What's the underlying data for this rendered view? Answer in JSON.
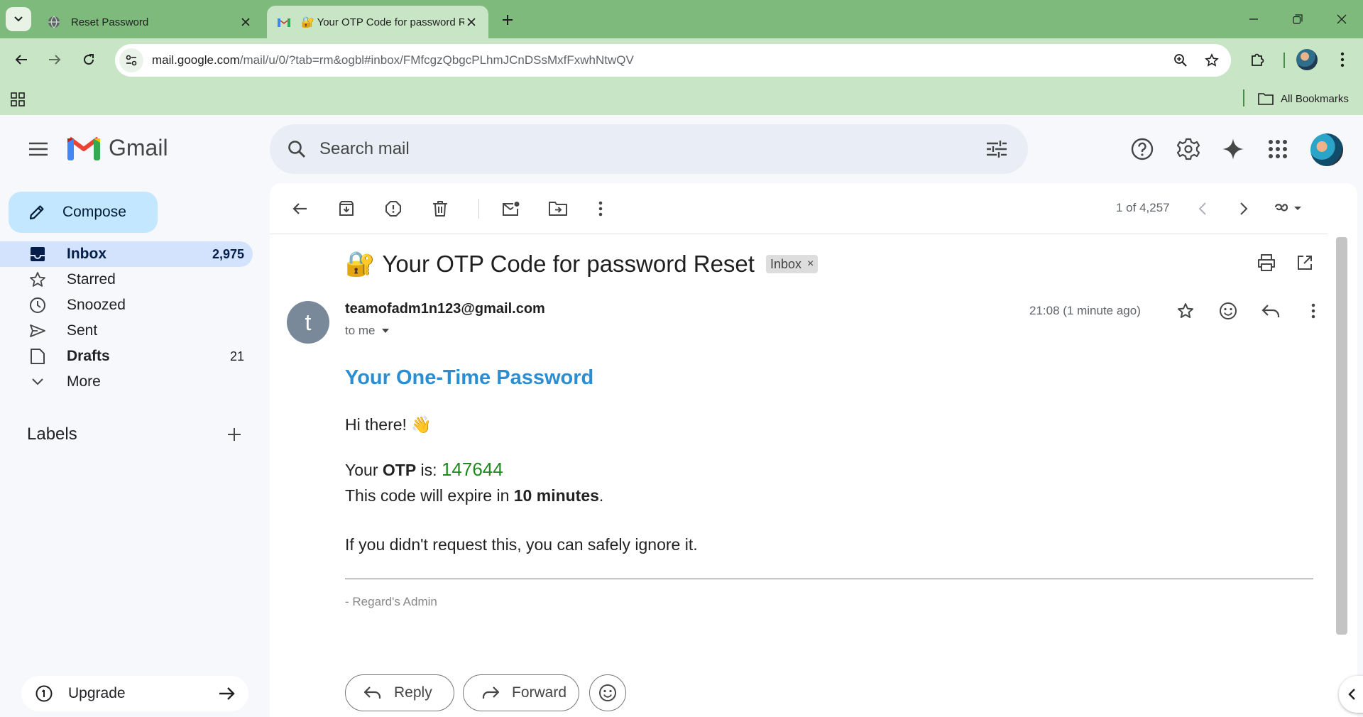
{
  "browser": {
    "tabs": [
      {
        "title": "Reset Password",
        "favicon": "globe-icon",
        "active": false
      },
      {
        "title": "Your OTP Code for password Reset",
        "favicon": "gmail-icon",
        "active": true
      }
    ],
    "url_host": "mail.google.com",
    "url_path": "/mail/u/0/?tab=rm&ogbl#inbox/FMfcgzQbgcPLhmJCnDSsMxfFxwhNtwQV",
    "bookmarks_label": "All Bookmarks",
    "theme_color": "#7dba7c",
    "toolbar_color": "#c8e6c6"
  },
  "gmail": {
    "logo_text": "Gmail",
    "search_placeholder": "Search mail",
    "compose_label": "Compose",
    "nav": [
      {
        "label": "Inbox",
        "count": "2,975",
        "icon": "inbox-icon"
      },
      {
        "label": "Starred",
        "count": "",
        "icon": "star-icon"
      },
      {
        "label": "Snoozed",
        "count": "",
        "icon": "clock-icon"
      },
      {
        "label": "Sent",
        "count": "",
        "icon": "send-icon"
      },
      {
        "label": "Drafts",
        "count": "21",
        "icon": "draft-icon"
      },
      {
        "label": "More",
        "count": "",
        "icon": "chevron-down-icon"
      }
    ],
    "labels_heading": "Labels",
    "upgrade_label": "Upgrade",
    "accent": "#c2e7ff",
    "active_nav_bg": "#d3e3fd"
  },
  "message": {
    "pager": "1 of 4,257",
    "subject_emoji": "🔐",
    "subject": "Your OTP Code for password Reset",
    "label_chip": "Inbox",
    "label_chip_close": "×",
    "sender_initial": "t",
    "sender": "teamofadm1n123@gmail.com",
    "to": "to me",
    "time": "21:08 (1 minute ago)",
    "body": {
      "heading": "Your One-Time Password",
      "greeting": "Hi there! 👋",
      "otp_prefix": "Your ",
      "otp_bold": "OTP",
      "otp_mid": " is: ",
      "otp_code": "147644",
      "expire_prefix": "This code will expire in ",
      "expire_bold": "10 minutes",
      "expire_suffix": ".",
      "ignore": "If you didn't request this, you can safely ignore it.",
      "signature": "- Regard's Admin"
    },
    "reply_label": "Reply",
    "forward_label": "Forward",
    "heading_color": "#2b8dd2",
    "otp_color": "#1e8a1e"
  }
}
